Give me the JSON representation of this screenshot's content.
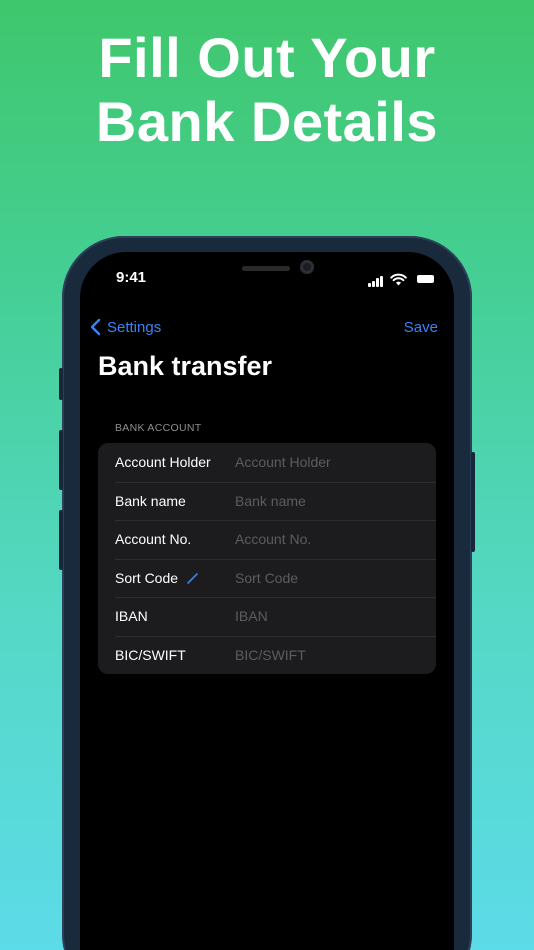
{
  "headline": {
    "line1": "Fill Out Your",
    "line2": "Bank Details"
  },
  "status_bar": {
    "time": "9:41",
    "icons": [
      "signal-icon",
      "wifi-icon",
      "battery-icon"
    ]
  },
  "nav": {
    "back_label": "Settings",
    "back_icon": "chevron-left-icon",
    "save_label": "Save"
  },
  "page_title": "Bank transfer",
  "section": {
    "header": "BANK ACCOUNT",
    "rows": [
      {
        "label": "Account Holder",
        "placeholder": "Account Holder",
        "value": ""
      },
      {
        "label": "Bank name",
        "placeholder": "Bank name",
        "value": ""
      },
      {
        "label": "Account No.",
        "placeholder": "Account No.",
        "value": ""
      },
      {
        "label": "Sort Code",
        "placeholder": "Sort Code",
        "value": "",
        "icon": "pencil-icon"
      },
      {
        "label": "IBAN",
        "placeholder": "IBAN",
        "value": ""
      },
      {
        "label": "BIC/SWIFT",
        "placeholder": "BIC/SWIFT",
        "value": ""
      }
    ]
  },
  "colors": {
    "accent": "#3b82f6",
    "background_top": "#3fc76c",
    "background_bottom": "#5cdbe8",
    "card": "#1c1c1e"
  }
}
